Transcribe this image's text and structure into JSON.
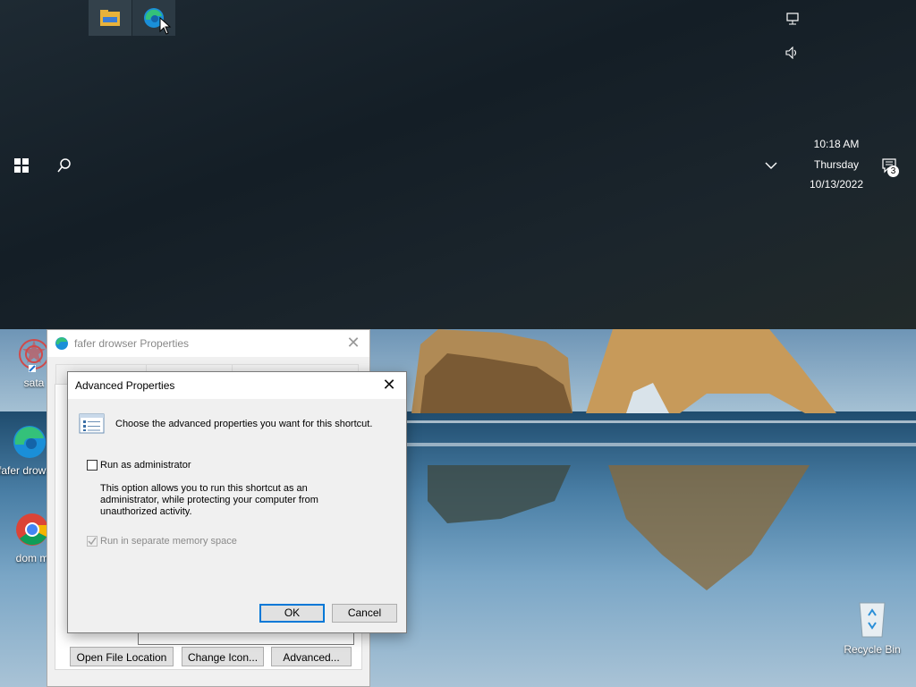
{
  "taskbar": {
    "pinned": [
      {
        "name": "file-explorer",
        "icon": "folder-icon"
      },
      {
        "name": "edge",
        "icon": "edge-icon"
      }
    ],
    "clock": {
      "time": "10:18 AM",
      "day": "Thursday",
      "date": "10/13/2022"
    },
    "notifications_count": "3"
  },
  "desktop_icons": [
    {
      "label": "sata",
      "icon": "app-icon"
    },
    {
      "label": "fafer drowser",
      "icon": "edge-icon"
    },
    {
      "label": "dom m",
      "icon": "chrome-icon"
    },
    {
      "label": "Recycle Bin",
      "icon": "recycle-bin-icon"
    }
  ],
  "properties_window": {
    "title": "fafer drowser Properties",
    "buttons": {
      "open_file_location": "Open File Location",
      "change_icon": "Change Icon...",
      "advanced": "Advanced..."
    }
  },
  "advanced_dialog": {
    "title": "Advanced Properties",
    "description": "Choose the advanced properties you want for this shortcut.",
    "run_as_admin": {
      "label": "Run as administrator",
      "checked": false,
      "help": "This option allows you to run this shortcut as an administrator, while protecting your computer from unauthorized activity."
    },
    "separate_memory": {
      "label": "Run in separate memory space",
      "checked": true,
      "enabled": false
    },
    "ok_label": "OK",
    "cancel_label": "Cancel"
  }
}
